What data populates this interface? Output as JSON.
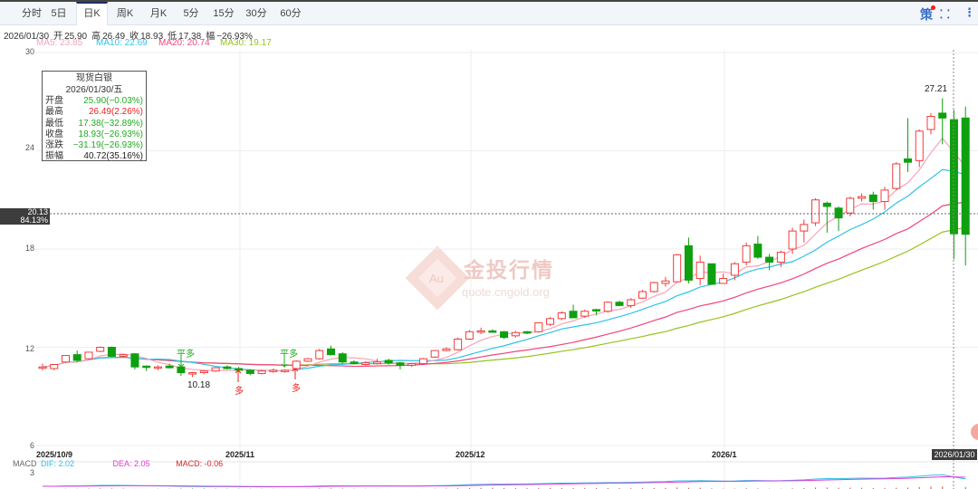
{
  "tabs": [
    {
      "label": "分时"
    },
    {
      "label": "5日"
    },
    {
      "label": "日K",
      "active": true
    },
    {
      "label": "周K"
    },
    {
      "label": "月K"
    },
    {
      "label": "5分"
    },
    {
      "label": "15分"
    },
    {
      "label": "30分"
    },
    {
      "label": "60分"
    }
  ],
  "toolbar": {
    "strategy_label": "策",
    "strategy_badge_color": "#ff1a1a",
    "collapse_icon": "compress-icon",
    "more_icon": "more-vertical-icon"
  },
  "quote": {
    "date": "2026/01/30",
    "open_label": "开",
    "open": "25.90",
    "high_label": "高",
    "high": "26.49",
    "close_label": "收",
    "close": "18.93",
    "low_label": "低",
    "low": "17.38",
    "change_label": "幅",
    "change": "−26.93%"
  },
  "ma": {
    "ma5": {
      "label": "MA5: 23.85",
      "color": "#f7a3b8"
    },
    "ma10": {
      "label": "MA10: 22.69",
      "color": "#2ec2e6"
    },
    "ma20": {
      "label": "MA20: 20.74",
      "color": "#f0457a"
    },
    "ma30": {
      "label": "MA30: 19.17",
      "color": "#98c21f"
    }
  },
  "tooltip": {
    "name": "现货白银",
    "date": "2026/01/30/五",
    "rows": [
      {
        "label": "开盘",
        "value": "25.90(−0.03%)",
        "color": "#22aa22"
      },
      {
        "label": "最高",
        "value": "26.49(2.26%)",
        "color": "#ee2222"
      },
      {
        "label": "最低",
        "value": "17.38(−32.89%)",
        "color": "#22aa22"
      },
      {
        "label": "收盘",
        "value": "18.93(−26.93%)",
        "color": "#22aa22"
      },
      {
        "label": "涨跌",
        "value": "−31.19(−26.93%)",
        "color": "#22aa22"
      },
      {
        "label": "振幅",
        "value": "40.72(35.16%)",
        "color": "#222222"
      }
    ]
  },
  "crosshair": {
    "price": "20.13",
    "percent": "84.13%",
    "date": "2026/01/30"
  },
  "y_ticks": [
    "30",
    "24",
    "18",
    "12",
    "6"
  ],
  "x_ticks": [
    "2025/10/9",
    "2025/11",
    "2025/12",
    "2026/1"
  ],
  "annotations": {
    "max": "27.21",
    "min": "10.18",
    "close_long": "平多",
    "open_long": "多"
  },
  "macd": {
    "title": "MACD",
    "dif": "DIF: 2.02",
    "dea": "DEA: 2.05",
    "macd": "MACD: -0.06",
    "tick": "3",
    "dif_color": "#2ec2e6",
    "dea_color": "#e23ad6",
    "macd_color": "#dd2222"
  },
  "watermark": {
    "brand": "金投行情",
    "url": "quote.cngold.org",
    "logo": "Au"
  },
  "colors": {
    "up": "#f03c3c",
    "down": "#0ea00e"
  },
  "chart_data": {
    "type": "candlestick",
    "ylim": [
      6,
      30
    ],
    "ohlc": [
      [
        10.75,
        11.0,
        10.6,
        10.8
      ],
      [
        10.7,
        10.95,
        10.6,
        10.95
      ],
      [
        11.1,
        11.45,
        11.05,
        11.5
      ],
      [
        11.55,
        11.8,
        11.1,
        11.2
      ],
      [
        11.3,
        11.7,
        11.25,
        11.7
      ],
      [
        11.75,
        12.05,
        11.7,
        12.0
      ],
      [
        12.0,
        12.05,
        11.4,
        11.45
      ],
      [
        11.45,
        11.6,
        11.35,
        11.55
      ],
      [
        11.6,
        11.65,
        10.65,
        10.8
      ],
      [
        10.85,
        10.9,
        10.55,
        10.8
      ],
      [
        10.75,
        10.9,
        10.6,
        10.8
      ],
      [
        10.85,
        11.0,
        10.7,
        10.75
      ],
      [
        10.8,
        10.9,
        10.25,
        10.45
      ],
      [
        10.4,
        10.5,
        10.18,
        10.45
      ],
      [
        10.45,
        10.6,
        10.35,
        10.55
      ],
      [
        10.55,
        10.8,
        10.5,
        10.75
      ],
      [
        10.8,
        10.9,
        10.65,
        10.7
      ],
      [
        10.7,
        10.8,
        10.55,
        10.6
      ],
      [
        10.6,
        10.65,
        10.3,
        10.4
      ],
      [
        10.4,
        10.6,
        10.35,
        10.55
      ],
      [
        10.55,
        10.7,
        10.45,
        10.6
      ],
      [
        10.55,
        10.65,
        10.45,
        10.6
      ],
      [
        10.7,
        11.2,
        10.65,
        11.15
      ],
      [
        11.15,
        11.35,
        11.1,
        11.3
      ],
      [
        11.3,
        11.9,
        11.25,
        11.8
      ],
      [
        11.9,
        12.1,
        11.5,
        11.55
      ],
      [
        11.6,
        11.7,
        11.0,
        11.1
      ],
      [
        11.1,
        11.2,
        10.95,
        11.0
      ],
      [
        10.95,
        11.15,
        10.9,
        11.05
      ],
      [
        11.0,
        11.3,
        10.95,
        11.1
      ],
      [
        11.2,
        11.3,
        10.95,
        11.05
      ],
      [
        11.05,
        11.1,
        10.65,
        10.9
      ],
      [
        10.9,
        11.05,
        10.8,
        11.0
      ],
      [
        11.0,
        11.35,
        10.95,
        11.3
      ],
      [
        11.4,
        11.8,
        11.35,
        11.8
      ],
      [
        11.8,
        12.0,
        11.75,
        11.9
      ],
      [
        11.85,
        12.6,
        11.8,
        12.5
      ],
      [
        12.5,
        13.05,
        12.45,
        12.95
      ],
      [
        12.95,
        13.2,
        12.8,
        13.0
      ],
      [
        13.0,
        13.1,
        12.9,
        12.95
      ],
      [
        12.95,
        13.0,
        12.5,
        12.6
      ],
      [
        12.7,
        13.0,
        12.6,
        12.9
      ],
      [
        12.95,
        13.0,
        12.8,
        12.9
      ],
      [
        12.95,
        13.5,
        12.9,
        13.5
      ],
      [
        13.4,
        13.85,
        13.3,
        13.75
      ],
      [
        13.75,
        14.2,
        13.65,
        14.1
      ],
      [
        14.2,
        14.6,
        13.8,
        13.8
      ],
      [
        13.9,
        14.3,
        13.8,
        14.2
      ],
      [
        14.3,
        14.35,
        13.95,
        14.25
      ],
      [
        14.2,
        14.8,
        14.1,
        14.75
      ],
      [
        14.75,
        14.85,
        14.5,
        14.55
      ],
      [
        14.55,
        15.0,
        14.4,
        14.9
      ],
      [
        15.0,
        15.5,
        14.95,
        15.4
      ],
      [
        15.4,
        16.0,
        15.35,
        15.95
      ],
      [
        15.9,
        16.3,
        15.7,
        16.05
      ],
      [
        16.0,
        17.7,
        15.95,
        17.65
      ],
      [
        18.2,
        18.7,
        15.9,
        16.1
      ],
      [
        16.2,
        17.6,
        15.8,
        17.2
      ],
      [
        17.1,
        17.1,
        15.8,
        15.85
      ],
      [
        15.9,
        16.5,
        15.9,
        16.2
      ],
      [
        16.4,
        17.2,
        16.1,
        17.1
      ],
      [
        17.2,
        18.4,
        17.0,
        18.2
      ],
      [
        18.3,
        18.8,
        17.4,
        17.5
      ],
      [
        17.5,
        17.7,
        16.7,
        17.2
      ],
      [
        17.2,
        17.9,
        16.9,
        17.8
      ],
      [
        18.0,
        19.3,
        17.7,
        19.1
      ],
      [
        19.1,
        19.8,
        18.4,
        19.5
      ],
      [
        19.6,
        21.1,
        19.4,
        21.0
      ],
      [
        20.8,
        20.9,
        19.0,
        20.6
      ],
      [
        20.5,
        20.6,
        19.1,
        19.9
      ],
      [
        20.2,
        21.2,
        20.0,
        21.1
      ],
      [
        21.1,
        21.4,
        20.9,
        21.2
      ],
      [
        21.3,
        21.5,
        20.4,
        20.9
      ],
      [
        20.9,
        21.8,
        20.4,
        21.6
      ],
      [
        21.7,
        23.3,
        21.6,
        23.2
      ],
      [
        23.5,
        26.0,
        22.7,
        23.3
      ],
      [
        23.4,
        25.3,
        23.0,
        25.2
      ],
      [
        25.3,
        26.3,
        25.0,
        26.1
      ],
      [
        26.3,
        27.21,
        24.4,
        26.0
      ],
      [
        25.9,
        26.49,
        17.38,
        18.93
      ],
      [
        26.0,
        26.7,
        17.0,
        18.9
      ]
    ]
  }
}
